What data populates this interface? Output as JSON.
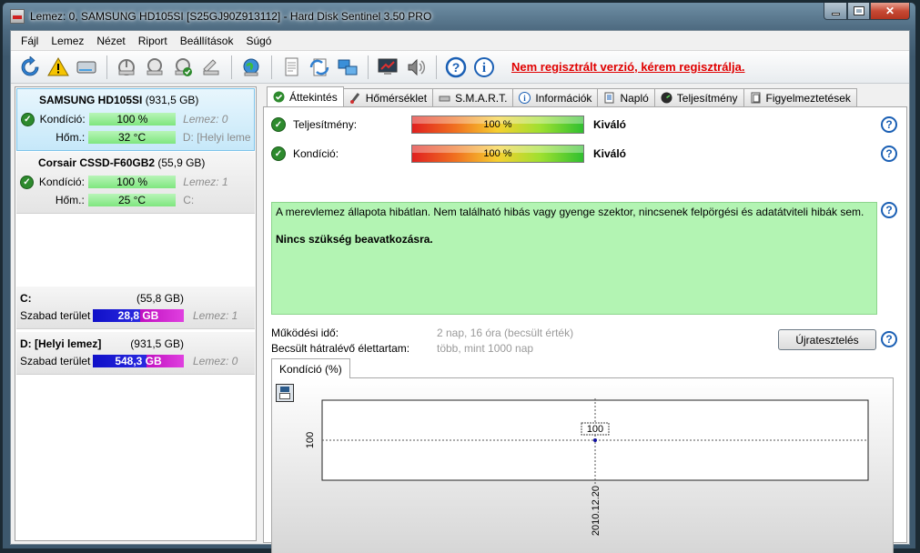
{
  "window": {
    "title": "Lemez: 0, SAMSUNG HD105SI [S25GJ90Z913112]  -  Hard Disk Sentinel 3.50 PRO"
  },
  "menu": {
    "items": [
      "Fájl",
      "Lemez",
      "Nézet",
      "Riport",
      "Beállítások",
      "Súgó"
    ]
  },
  "toolbar": {
    "icons": [
      "refresh-icon",
      "warning-icon",
      "disk-icon",
      "disk-temp-icon",
      "disk-settings-icon",
      "disk-check-icon",
      "disk-tools-icon",
      "globe-icon",
      "report-icon",
      "send-report-icon",
      "network-icon",
      "benchmark-icon",
      "sound-icon",
      "help-icon",
      "info-icon"
    ],
    "registration_warning": "Nem regisztrált verzió, kérem regisztrálja."
  },
  "disks": [
    {
      "name": "SAMSUNG HD105SI",
      "size": "(931,5 GB)",
      "condition_label": "Kondíció:",
      "condition_value": "100 %",
      "condition_extra": "Lemez: 0",
      "temp_label": "Hőm.:",
      "temp_value": "32 °C",
      "temp_extra": "D: [Helyi lemez]"
    },
    {
      "name": "Corsair CSSD-F60GB2",
      "size": "(55,9 GB)",
      "condition_label": "Kondíció:",
      "condition_value": "100 %",
      "condition_extra": "Lemez: 1",
      "temp_label": "Hőm.:",
      "temp_value": "25 °C",
      "temp_extra": "C:"
    }
  ],
  "volumes": [
    {
      "name": "C:",
      "size": "(55,8 GB)",
      "free_label": "Szabad terület",
      "free_value": "28,8 GB",
      "free_fraction": 0.516,
      "disk": "Lemez: 1"
    },
    {
      "name": "D: [Helyi lemez]",
      "size": "(931,5 GB)",
      "free_label": "Szabad terület",
      "free_value": "548,3 GB",
      "free_fraction": 0.589,
      "disk": "Lemez: 0"
    }
  ],
  "tabs": [
    {
      "label": "Áttekintés",
      "icon": "check-icon"
    },
    {
      "label": "Hőmérséklet",
      "icon": "thermometer-icon"
    },
    {
      "label": "S.M.A.R.T.",
      "icon": "smart-icon"
    },
    {
      "label": "Információk",
      "icon": "info-icon"
    },
    {
      "label": "Napló",
      "icon": "log-icon"
    },
    {
      "label": "Teljesítmény",
      "icon": "performance-icon"
    },
    {
      "label": "Figyelmeztetések",
      "icon": "alerts-icon"
    }
  ],
  "overview": {
    "performance_label": "Teljesítmény:",
    "performance_value": "100 %",
    "performance_rating": "Kiváló",
    "condition_label": "Kondíció:",
    "condition_value": "100 %",
    "condition_rating": "Kiváló",
    "description": "A merevlemez állapota hibátlan. Nem található hibás vagy gyenge szektor, nincsenek felpörgési és adatátviteli hibák sem.",
    "recommendation": "Nincs szükség beavatkozásra.",
    "uptime_label": "Működési idő:",
    "uptime_value": "2 nap, 16 óra (becsült érték)",
    "lifetime_label": "Becsült hátralévő élettartam:",
    "lifetime_value": "több, mint 1000 nap",
    "retest_button": "Újratesztelés",
    "chart_tab": "Kondíció  (%)"
  },
  "colors": {
    "accent_blue": "#1a5fb4",
    "ok_green": "#2d8a2d",
    "desc_bg": "#b3f4b3",
    "warning_red": "#e00000"
  },
  "chart_data": {
    "type": "line",
    "title": "",
    "xlabel": "",
    "ylabel": "",
    "x": [
      "2010.12.20"
    ],
    "series": [
      {
        "values": [
          100
        ]
      }
    ],
    "data_labels": [
      "100"
    ],
    "y_ticks": [
      "100"
    ],
    "grid": false
  }
}
